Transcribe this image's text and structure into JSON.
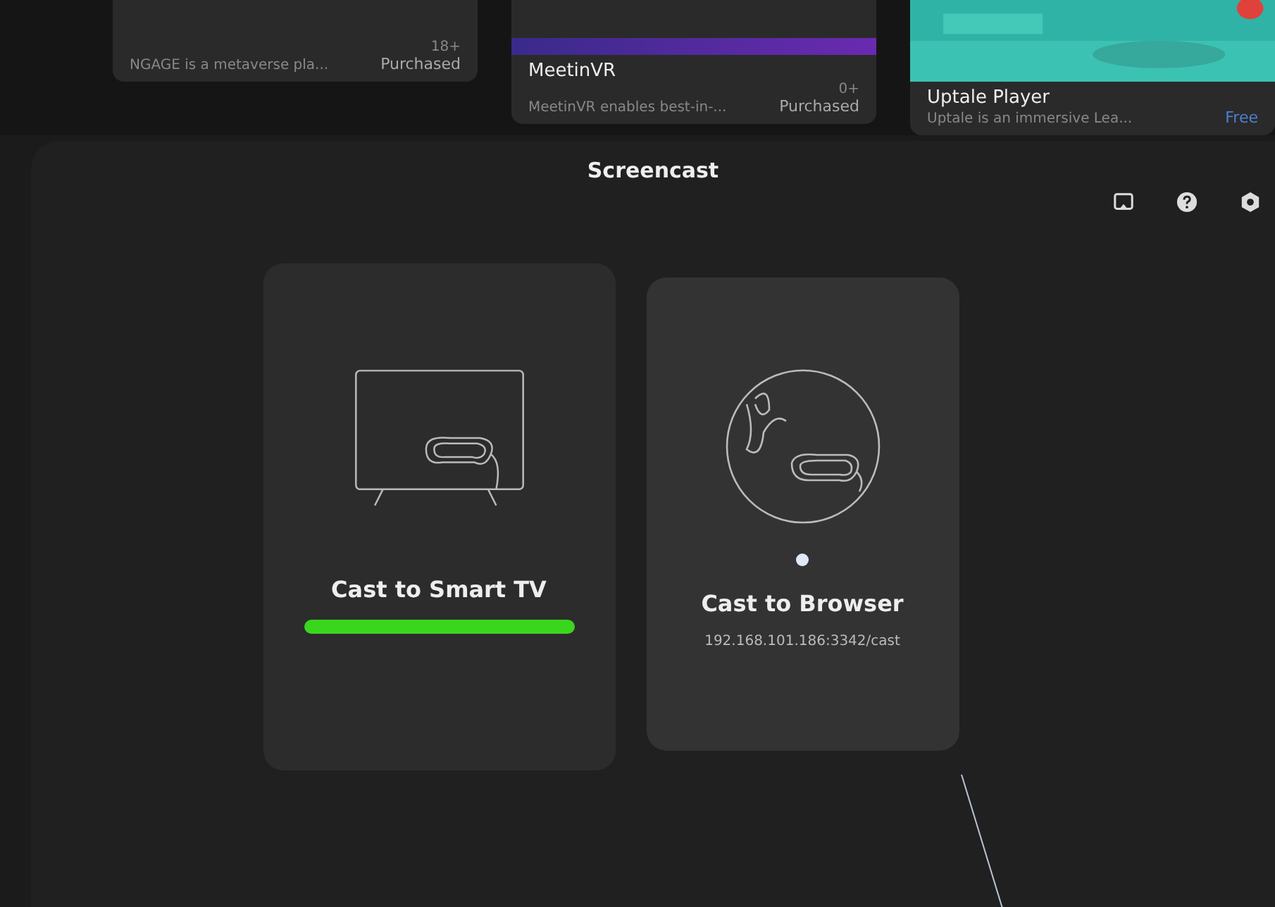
{
  "store_cards": [
    {
      "kind": "app",
      "description": "NGAGE is a metaverse pla...",
      "age": "18+",
      "price": "Purchased"
    },
    {
      "kind": "app",
      "title": "MeetinVR",
      "description": "MeetinVR enables best-in-...",
      "age": "0+",
      "price": "Purchased"
    },
    {
      "kind": "picture",
      "title": "Uptale Player",
      "description": "Uptale is an immersive Lea...",
      "price": "Free"
    }
  ],
  "panel": {
    "title": "Screencast"
  },
  "options": [
    {
      "kind": "tv",
      "label": "Cast to Smart TV",
      "selected": true,
      "pointer": false
    },
    {
      "kind": "browser",
      "label": "Cast to Browser",
      "address": "192.168.101.186:3342/cast",
      "selected": false,
      "pointer": true
    }
  ]
}
